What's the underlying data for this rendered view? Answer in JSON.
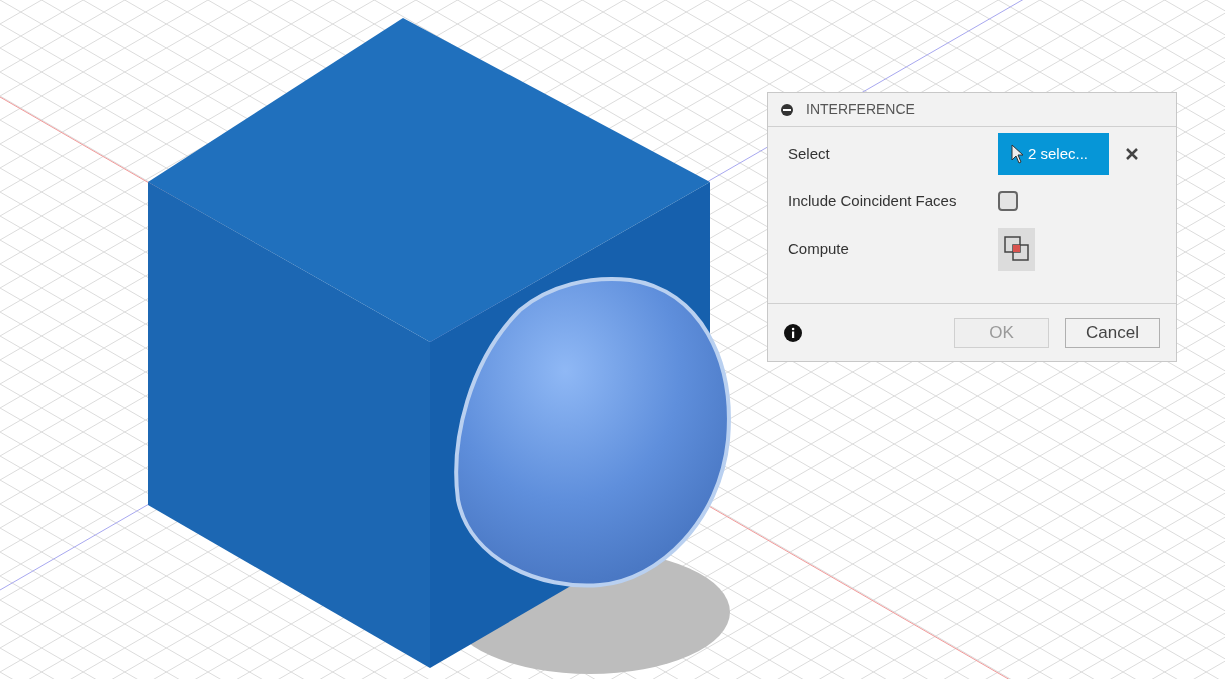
{
  "dialog": {
    "title": "INTERFERENCE",
    "rows": [
      {
        "kind": "selection",
        "label": "Select",
        "value": "2 selec..."
      },
      {
        "kind": "checkbox",
        "label": "Include Coincident Faces",
        "checked": false
      },
      {
        "kind": "action",
        "label": "Compute"
      }
    ],
    "buttons": [
      {
        "label": "OK",
        "disabled": true
      },
      {
        "label": "Cancel",
        "disabled": false
      }
    ]
  }
}
